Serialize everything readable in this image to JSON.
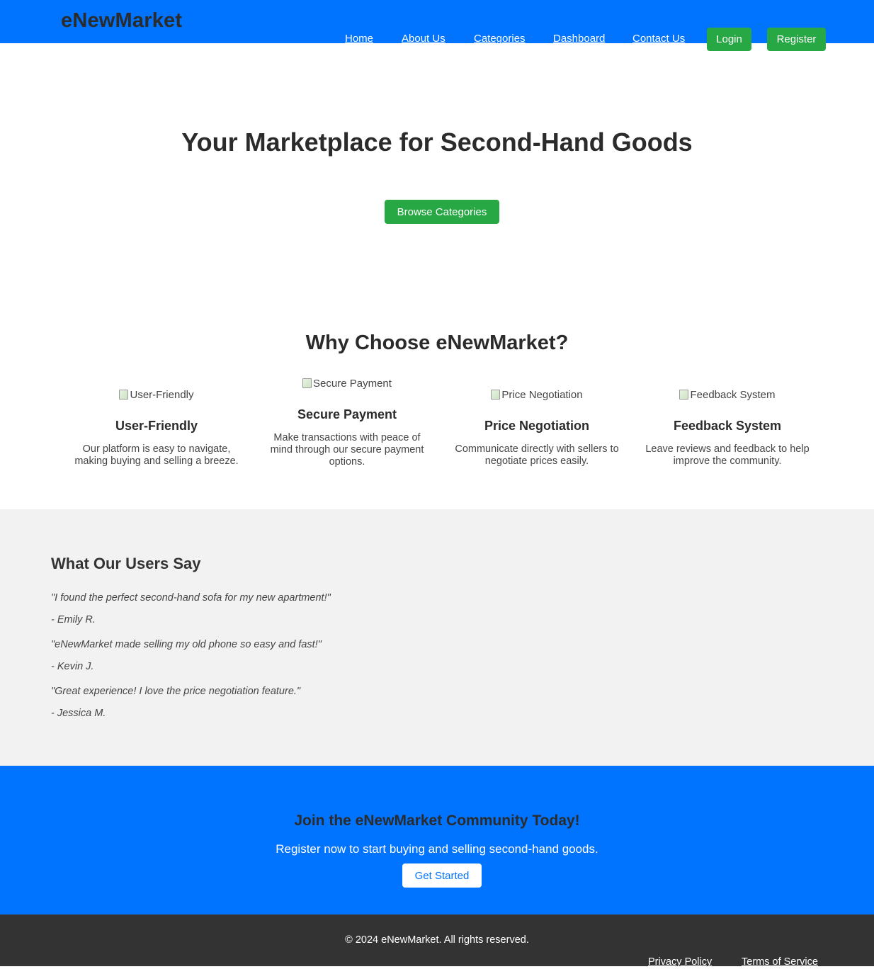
{
  "header": {
    "logo": "eNewMarket",
    "nav": {
      "home": "Home",
      "about": "About Us",
      "categories": "Categories",
      "dashboard": "Dashboard",
      "contact": "Contact Us"
    },
    "login_label": "Login",
    "register_label": "Register"
  },
  "hero": {
    "title": "Your Marketplace for Second-Hand Goods",
    "button_label": "Browse Categories"
  },
  "features": {
    "title": "Why Choose eNewMarket?",
    "items": [
      {
        "image_alt": "User-Friendly",
        "title": "User-Friendly",
        "description": "Our platform is easy to navigate, making buying and selling a breeze."
      },
      {
        "image_alt": "Secure Payment",
        "title": "Secure Payment",
        "description": "Make transactions with peace of mind through our secure payment options."
      },
      {
        "image_alt": "Price Negotiation",
        "title": "Price Negotiation",
        "description": "Communicate directly with sellers to negotiate prices easily."
      },
      {
        "image_alt": "Feedback System",
        "title": "Feedback System",
        "description": "Leave reviews and feedback to help improve the community."
      }
    ]
  },
  "testimonials": {
    "title": "What Our Users Say",
    "items": [
      {
        "quote": "\"I found the perfect second-hand sofa for my new apartment!\"",
        "author": "- Emily R."
      },
      {
        "quote": "\"eNewMarket made selling my old phone so easy and fast!\"",
        "author": "- Kevin J."
      },
      {
        "quote": "\"Great experience! I love the price negotiation feature.\"",
        "author": "- Jessica M."
      }
    ]
  },
  "cta": {
    "title": "Join the eNewMarket Community Today!",
    "text": "Register now to start buying and selling second-hand goods.",
    "button_label": "Get Started"
  },
  "footer": {
    "copyright": "© 2024 eNewMarket. All rights reserved.",
    "privacy": "Privacy Policy",
    "terms": "Terms of Service"
  },
  "colors": {
    "primary_blue": "#0073ff",
    "accent_green": "#28a745",
    "footer_dark": "#333333",
    "section_gray": "#f2f2f2"
  },
  "icons": {
    "feature_image": "broken-image-icon"
  }
}
